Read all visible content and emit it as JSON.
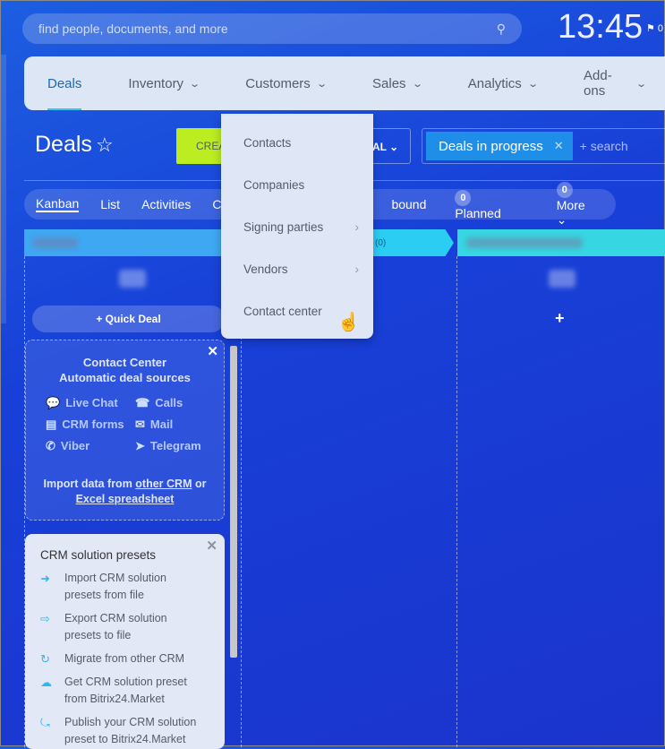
{
  "search": {
    "placeholder": "find people, documents, and more"
  },
  "clock": "13:45",
  "notif": "0",
  "nav": [
    {
      "label": "Deals",
      "active": true
    },
    {
      "label": "Inventory"
    },
    {
      "label": "Customers"
    },
    {
      "label": "Sales"
    },
    {
      "label": "Analytics"
    },
    {
      "label": "Add-ons"
    }
  ],
  "page": {
    "title": "Deals",
    "create_label": "CREATE",
    "all_label": "AL"
  },
  "filter": {
    "tag": "Deals in progress",
    "placeholder": "+ search"
  },
  "views": {
    "kanban": "Kanban",
    "list": "List",
    "activities": "Activities",
    "c": "C",
    "inbound": "bound",
    "planned_count": "0",
    "planned": "Planned",
    "more_count": "0",
    "more": "More"
  },
  "stage2_count": "(0)",
  "quick_deal": "+ Quick Deal",
  "add_plus": "+",
  "contact_center": {
    "title": "Contact Center",
    "subtitle": "Automatic deal sources",
    "sources": [
      "Live Chat",
      "Calls",
      "CRM forms",
      "Mail",
      "Viber",
      "Telegram"
    ],
    "import_prefix": "Import data from",
    "other_crm": "other CRM",
    "or": "or",
    "excel": "Excel spreadsheet"
  },
  "presets": {
    "title": "CRM solution presets",
    "items": [
      "Import CRM solution presets from file",
      "Export CRM solution presets to file",
      "Migrate from other CRM",
      "Get CRM solution preset from Bitrix24.Market",
      "Publish your CRM solution preset to Bitrix24.Market"
    ]
  },
  "menu": [
    {
      "label": "Contacts"
    },
    {
      "label": "Companies"
    },
    {
      "label": "Signing parties",
      "submenu": true
    },
    {
      "label": "Vendors",
      "submenu": true
    },
    {
      "label": "Contact center"
    }
  ],
  "colors": {
    "accent": "#2fc6f6",
    "create": "#bbed21",
    "stage1": "#3ea8f2",
    "stage2": "#2ccdf2",
    "stage3": "#36d6e2"
  }
}
